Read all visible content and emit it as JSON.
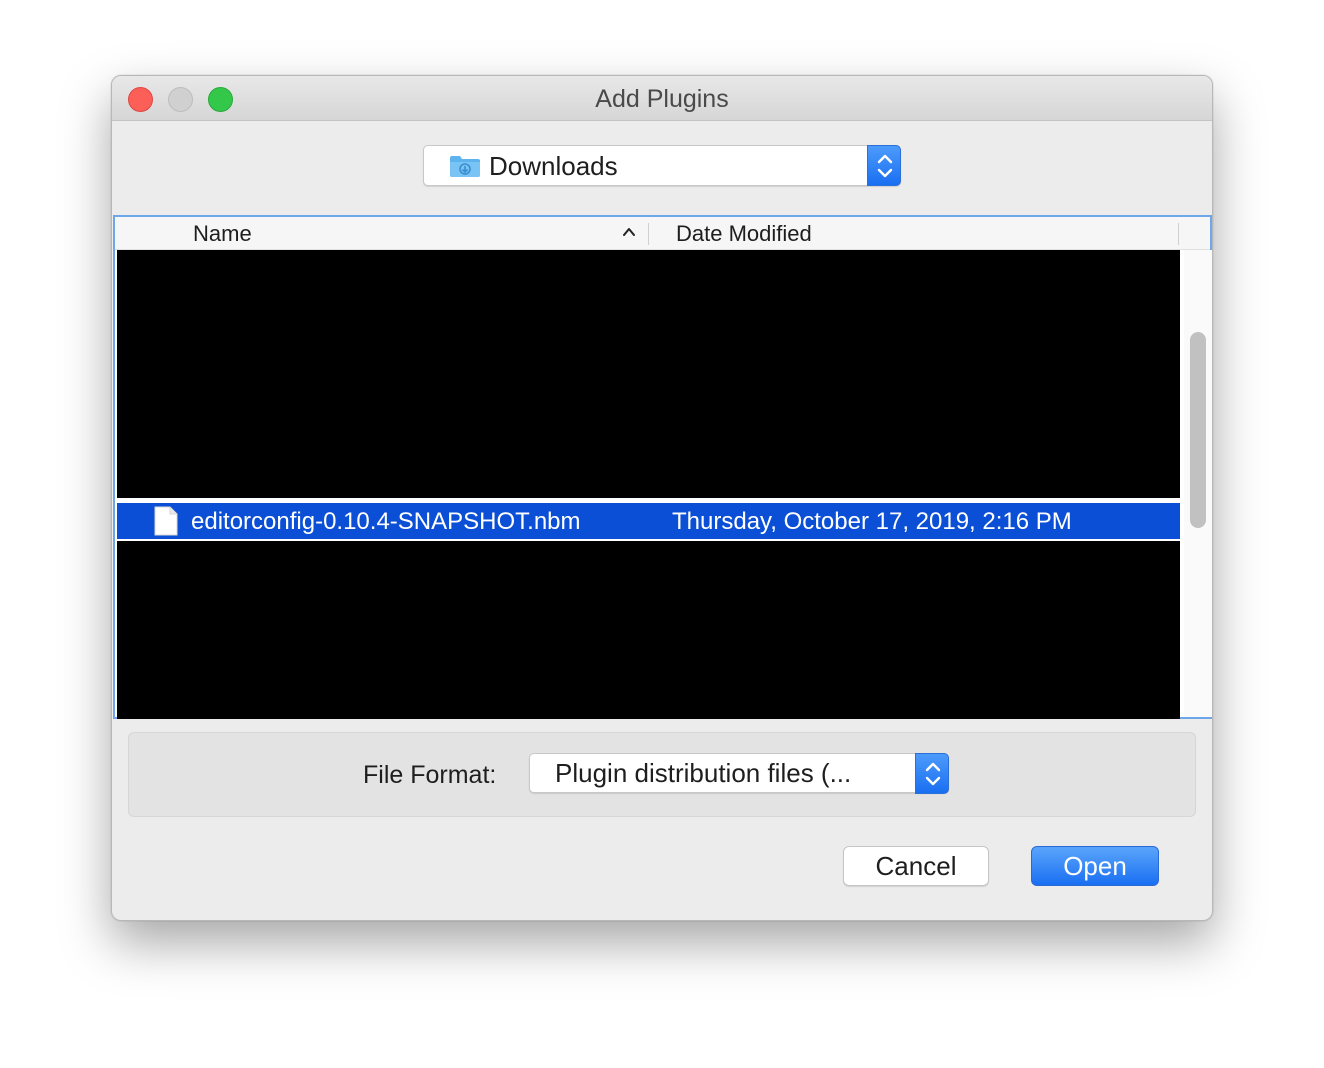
{
  "window": {
    "title": "Add Plugins"
  },
  "location": {
    "current_folder": "Downloads",
    "folder_icon": "downloads-folder-icon"
  },
  "file_list": {
    "columns": [
      "Name",
      "Date Modified"
    ],
    "sort_column": "Name",
    "sort_direction": "ascending",
    "selected_row": {
      "name": "editorconfig-0.10.4-SNAPSHOT.nbm",
      "date_modified": "Thursday, October 17, 2019, 2:16 PM",
      "icon": "document-icon"
    }
  },
  "file_format": {
    "label": "File Format:",
    "selected": "Plugin distribution files (..."
  },
  "buttons": {
    "cancel": "Cancel",
    "open": "Open"
  },
  "colors": {
    "accent": "#1a6ff2",
    "selection": "#0b4fd6",
    "close": "#fc5f57",
    "zoom": "#34c84a"
  }
}
